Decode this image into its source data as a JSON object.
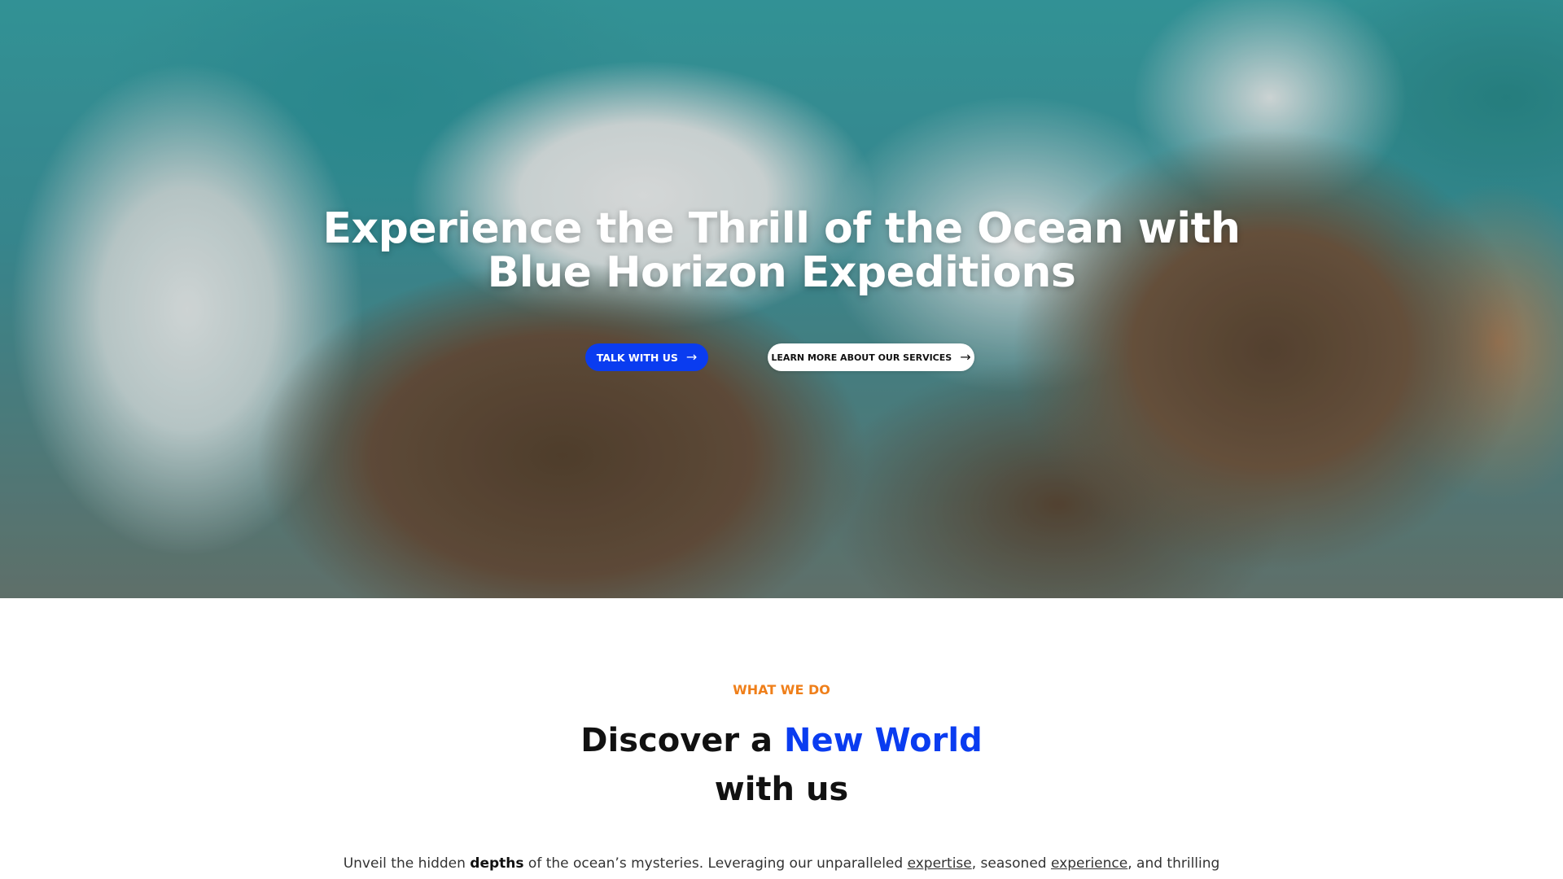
{
  "hero": {
    "title_line1": "Experience the Thrill of the Ocean with",
    "title_line2": "Blue Horizon Expeditions",
    "primary_button": "TALK WITH US",
    "secondary_button": "LEARN MORE ABOUT OUR SERVICES",
    "arrow_icon": "arrow-right-icon"
  },
  "section": {
    "eyebrow": "WHAT WE DO",
    "title_part1": "Discover a",
    "title_accent": "New World",
    "title_part2": "with us",
    "body_part1": "Unveil the hidden",
    "body_bold": "depths",
    "body_part2": "of  the ocean’s mysteries. Leveraging our unparalleled",
    "body_link1": "expertise",
    "body_part3": ", seasoned",
    "body_link2": "experience",
    "body_part4": ", and thrilling"
  },
  "colors": {
    "accent_blue": "#0a3cf0",
    "eyebrow_orange": "#ef7f1a",
    "text_dark": "#111111"
  }
}
